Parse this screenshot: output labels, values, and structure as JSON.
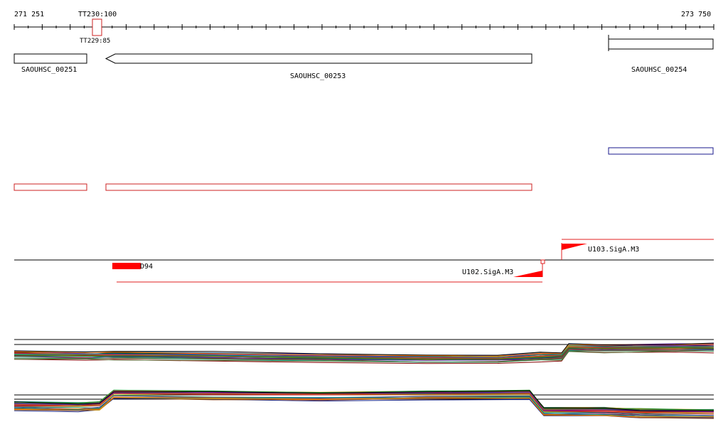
{
  "ruler": {
    "start_label": "271 251",
    "end_label": "273 750",
    "marker_label": "TT230:100",
    "marker_sublabel": "TT229:85"
  },
  "genes": [
    {
      "id": "SAOUHSC_00251",
      "label": "SAOUHSC_00251",
      "strand": "none"
    },
    {
      "id": "SAOUHSC_00253",
      "label": "SAOUHSC_00253",
      "strand": "minus"
    },
    {
      "id": "SAOUHSC_00254",
      "label": "SAOUHSC_00254",
      "strand": "none"
    }
  ],
  "features": {
    "d94_label": "D94",
    "u102_label": "U102.SigA.M3",
    "u103_label": "U103.SigA.M3"
  },
  "colors": {
    "feature_red": "#ff0000",
    "annotation_blue": "#1a1a8c",
    "outline": "#000000"
  }
}
